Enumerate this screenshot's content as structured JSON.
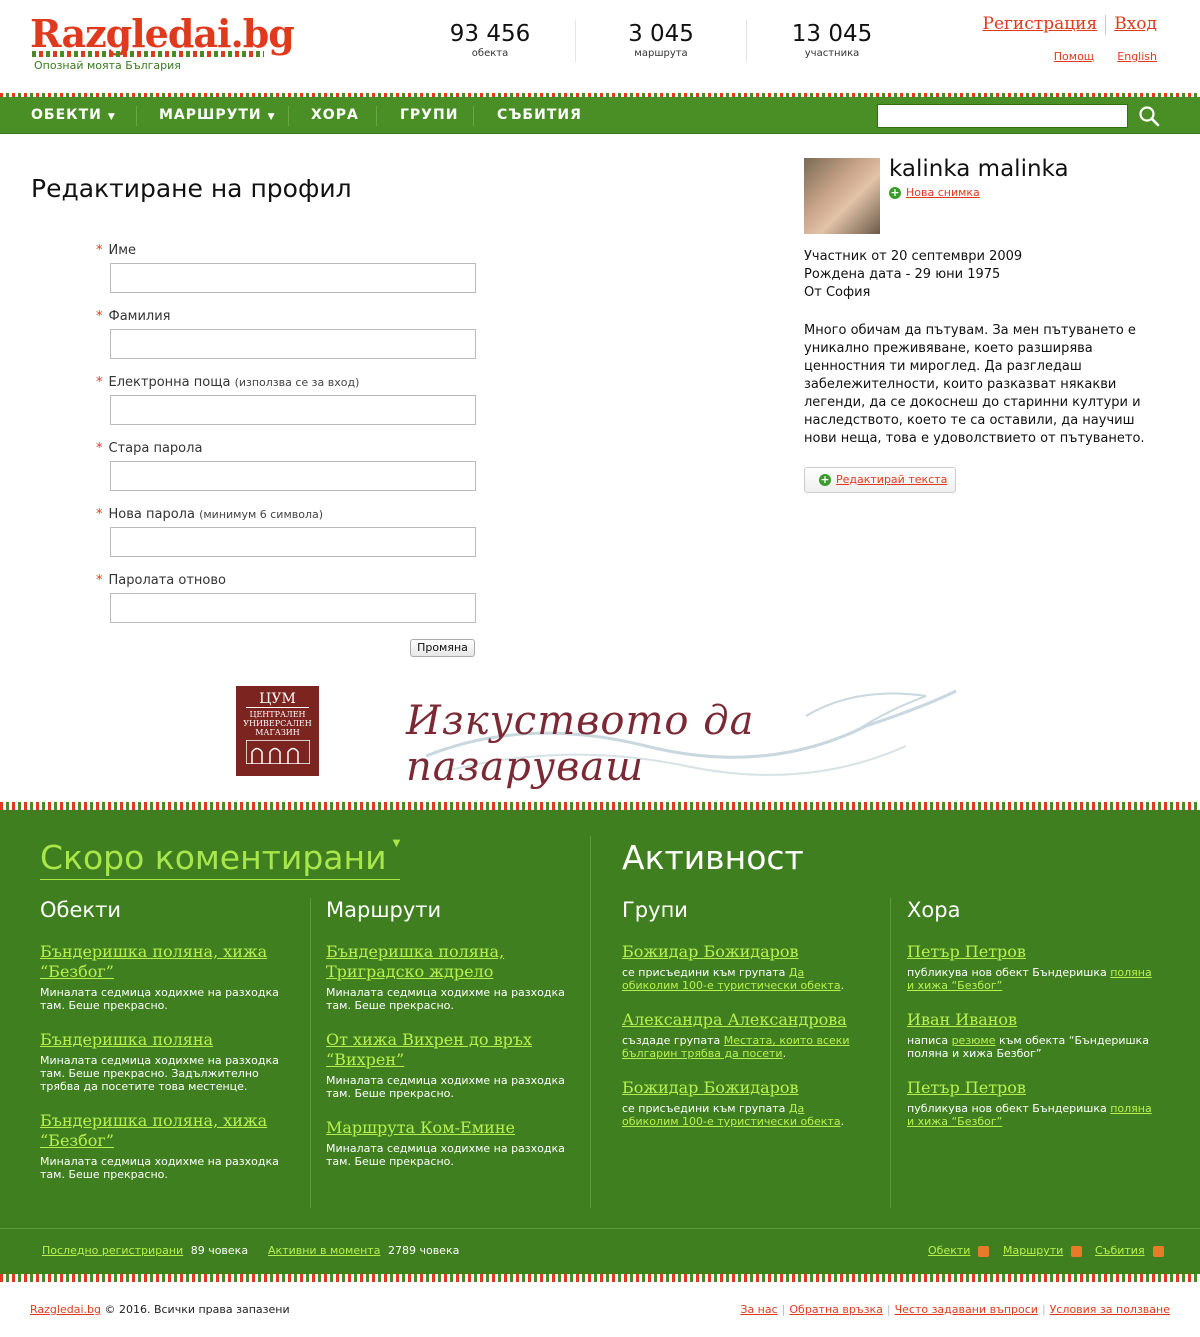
{
  "header": {
    "logo": "Razgledai.bg",
    "tagline": "Опознай моята България",
    "stats": [
      {
        "num": "93 456",
        "label": "обекта"
      },
      {
        "num": "3 045",
        "label": "маршрута"
      },
      {
        "num": "13 045",
        "label": "участника"
      }
    ],
    "register": "Регистрация",
    "login": "Вход",
    "help": "Помощ",
    "english": "English"
  },
  "nav": {
    "items": [
      "ОБЕКТИ",
      "МАРШРУТИ",
      "ХОРА",
      "ГРУПИ",
      "СЪБИТИЯ"
    ],
    "search_placeholder": ""
  },
  "form": {
    "title": "Редактиране на профил",
    "fields": [
      {
        "label": "Име",
        "hint": ""
      },
      {
        "label": "Фамилия",
        "hint": ""
      },
      {
        "label": "Електронна поща",
        "hint": "(използва се за вход)"
      },
      {
        "label": "Стара парола",
        "hint": ""
      },
      {
        "label": "Нова парола",
        "hint": "(минимум 6 символа)"
      },
      {
        "label": "Паролата отново",
        "hint": ""
      }
    ],
    "submit": "Промяна"
  },
  "profile": {
    "name": "kalinka malinka",
    "new_photo": "Нова снимка",
    "member_since": "Участник от 20 септември 2009",
    "birth_date": "Рождена дата - 29 юни 1975",
    "from": "От София",
    "bio": "Много обичам да пътувам. За мен пътуването е уникално преживяване, което разширява ценностния ти мироглед. Да разгледаш забележителности, които разказват някакви легенди, да се докоснеш до старинни култури и наследството, което те са оставили, да научиш нови неща, това е удоволствието от пътуването.",
    "edit_text": "Редактирай текста"
  },
  "ad": {
    "logo_l1": "ЦУМ",
    "logo_l2": "ЦЕНТРАЛЕН",
    "logo_l3": "УНИВЕРСАЛЕН",
    "logo_l4": "МАГАЗИН",
    "slogan": "Изкуството да пазаруваш"
  },
  "footer": {
    "recent_title": "Скоро коментирани",
    "activity_title": "Активност",
    "objects_title": "Обекти",
    "routes_title": "Маршрути",
    "groups_title": "Групи",
    "people_title": "Хора",
    "objects": [
      {
        "title": "Бъндеришка поляна, хижа “Безбог”",
        "desc": "Миналата седмица ходихме на разходка там. Беше прекрасно."
      },
      {
        "title": "Бъндеришка поляна",
        "desc": "Миналата седмица ходихме на разходка там. Беше прекрасно. Задължително трябва да посетите това местенце."
      },
      {
        "title": "Бъндеришка поляна, хижа “Безбог”",
        "desc": "Миналата седмица ходихме на разходка там. Беше прекрасно."
      }
    ],
    "routes": [
      {
        "title": "Бъндеришка поляна, Триградско ждрело",
        "desc": "Миналата седмица ходихме на разходка там. Беше прекрасно."
      },
      {
        "title": "От хижа Вихрен до връх “Вихрен”",
        "desc": "Миналата седмица ходихме на разходка там. Беше прекрасно."
      },
      {
        "title": "Маршрута Ком-Емине",
        "desc": "Миналата седмица ходихме на разходка там. Беше прекрасно."
      }
    ],
    "groups": [
      {
        "title": "Божидар Божидаров",
        "pre": "се присъедини към групата ",
        "link": "Да обиколим 100-е туристически обекта",
        "post": "."
      },
      {
        "title": "Александра Александрова",
        "pre": "създаде групата ",
        "link": "Местата, които всеки българин трябва да посети",
        "post": "."
      },
      {
        "title": "Божидар Божидаров",
        "pre": "се присъедини към групата ",
        "link": "Да обиколим 100-е туристически обекта",
        "post": "."
      }
    ],
    "people": [
      {
        "title": "Петър Петров",
        "pre": "публикува нов обект Бъндеришка ",
        "link": "поляна и хижа “Безбог”",
        "post": ""
      },
      {
        "title": "Иван Иванов",
        "pre": "написа ",
        "link": "резюме",
        "post": " към обекта “Бъндеришка поляна и хижа Безбог”"
      },
      {
        "title": "Петър Петров",
        "pre": "публикува нов обект Бъндеришка ",
        "link": "поляна и хижа “Безбог”",
        "post": ""
      }
    ]
  },
  "footer_bar": {
    "last_registered": "Последно регистрирани",
    "last_registered_count": "89 човека",
    "active_now": "Активни в момента",
    "active_now_count": "2789 човека",
    "rss": [
      "Обекти",
      "Маршрути",
      "Събития"
    ]
  },
  "bottom": {
    "site": "Razgledai.bg",
    "copyright": "© 2016. Всички права запазени",
    "links": [
      "За нас",
      "Обратна връзка",
      "Често задавани въпроси",
      "Условия за ползване"
    ]
  }
}
